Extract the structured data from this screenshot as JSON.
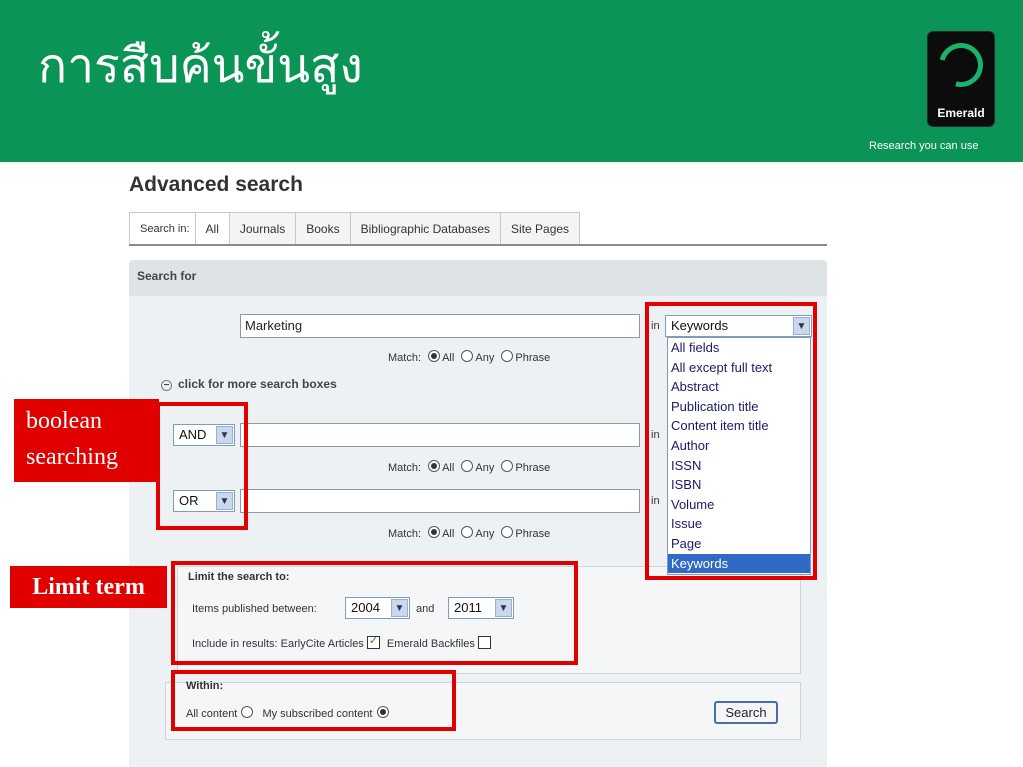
{
  "slide": {
    "title": "การสืบค้นขั้นสูง",
    "logo_text": "Emerald",
    "tagline": "Research you can use"
  },
  "page": {
    "heading": "Advanced search",
    "tabs_lead": "Search in:",
    "tabs": [
      "All",
      "Journals",
      "Books",
      "Bibliographic Databases",
      "Site Pages"
    ],
    "active_tab": "All",
    "search_for_label": "Search for"
  },
  "rows": [
    {
      "operator": "",
      "term": "Marketing",
      "in_label": "in",
      "field": "Keywords"
    },
    {
      "operator": "AND",
      "term": "",
      "in_label": "in"
    },
    {
      "operator": "OR",
      "term": "",
      "in_label": "in"
    }
  ],
  "match": {
    "label": "Match:",
    "options": [
      "All",
      "Any",
      "Phrase"
    ],
    "selected": "All"
  },
  "more_boxes": "click for more search boxes",
  "field_dropdown": {
    "options": [
      "All fields",
      "All except full text",
      "Abstract",
      "Publication title",
      "Content item title",
      "Author",
      "ISSN",
      "ISBN",
      "Volume",
      "Issue",
      "Page",
      "Keywords"
    ],
    "selected": "Keywords"
  },
  "limit": {
    "heading": "Limit the search to:",
    "published_label": "Items published between:",
    "from_year": "2004",
    "and_label": "and",
    "to_year": "2011",
    "include_label": "Include in results:",
    "earlycite_label": "EarlyCite Articles",
    "earlycite_checked": true,
    "backfiles_label": "Emerald Backfiles",
    "backfiles_checked": false
  },
  "within": {
    "heading": "Within:",
    "all_content": "All content",
    "subscribed": "My subscribed content",
    "selected": "My subscribed content"
  },
  "search_button": "Search",
  "callouts": {
    "boolean": "boolean searching",
    "limit_term": "Limit term"
  },
  "colors": {
    "banner": "#0a9456",
    "callout": "#e00000",
    "selected_option": "#3169c6"
  }
}
